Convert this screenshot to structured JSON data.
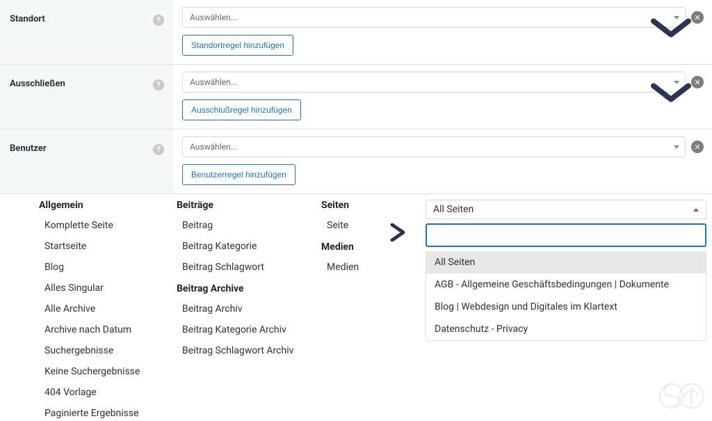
{
  "rules": {
    "standort": {
      "label": "Standort",
      "placeholder": "Auswählen...",
      "add_button": "Standortregel hinzufügen"
    },
    "ausschliessen": {
      "label": "Ausschließen",
      "placeholder": "Auswählen...",
      "add_button": "Ausschlußregel hinzufügen"
    },
    "benutzer": {
      "label": "Benutzer",
      "placeholder": "Auswählen...",
      "add_button": "Benutzerregel hinzufügen"
    }
  },
  "taxonomy": {
    "allgemein": {
      "header": "Allgemein",
      "items": [
        "Komplette Seite",
        "Startseite",
        "Blog",
        "Alles Singular",
        "Alle Archive",
        "Archive nach Datum",
        "Suchergebnisse",
        "Keine Suchergebnisse",
        "404 Vorlage",
        "Paginierte Ergebnisse"
      ]
    },
    "beitraege": {
      "header": "Beiträge",
      "items": [
        "Beitrag",
        "Beitrag Kategorie",
        "Beitrag Schlagwort"
      ]
    },
    "beitrag_archive": {
      "header": "Beitrag Archive",
      "items": [
        "Beitrag Archiv",
        "Beitrag Kategorie Archiv",
        "Beitrag Schlagwort Archiv"
      ]
    },
    "seiten": {
      "header": "Seiten",
      "items": [
        "Seite"
      ]
    },
    "medien": {
      "header": "Medien",
      "items": [
        "Medien"
      ]
    }
  },
  "page_picker": {
    "selected": "All Seiten",
    "search_value": "",
    "options": [
      "All Seiten",
      "AGB - Allgemeine Geschäftsbedingungen | Dokumente",
      "Blog | Webdesign und Digitales im Klartext",
      "Datenschutz - Privacy"
    ],
    "highlighted_index": 0
  },
  "icons": {
    "help": "?",
    "remove": "✕"
  }
}
